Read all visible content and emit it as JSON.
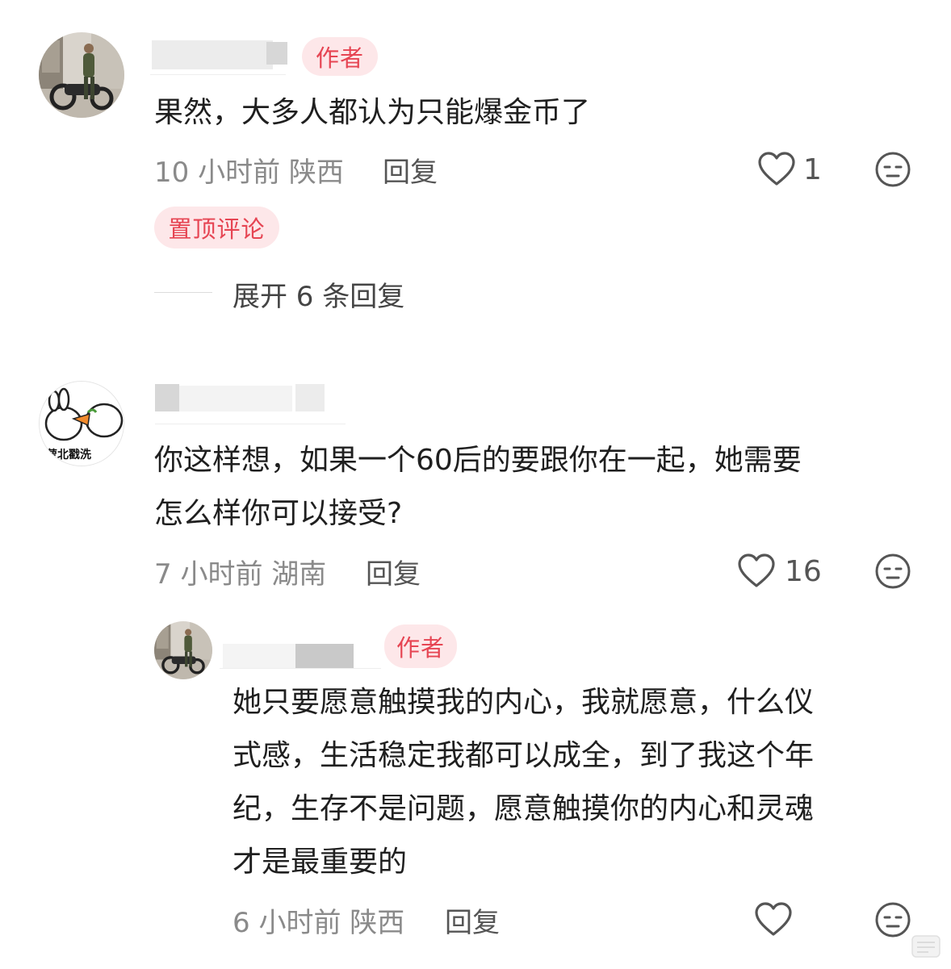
{
  "comments": [
    {
      "author_badge": "作者",
      "text": "果然，大多人都认为只能爆金币了",
      "time_location": "10 小时前 陕西",
      "reply_label": "回复",
      "likes": "1",
      "pinned_label": "置顶评论",
      "expand_label": "展开 6 条回复"
    },
    {
      "text_lines": [
        "你这样想，如果一个60后的要跟你在一起，她需要",
        "怎么样你可以接受?"
      ],
      "time_location": "7 小时前 湖南",
      "reply_label": "回复",
      "likes": "16",
      "avatar_text": "萝北戳洗"
    }
  ],
  "reply": {
    "author_badge": "作者",
    "text_lines": [
      "她只要愿意触摸我的内心，我就愿意，什么仪",
      "式感，生活稳定我都可以成全，到了我这个年",
      "纪，生存不是问题，愿意触摸你的内心和灵魂",
      "才是最重要的"
    ],
    "time_location": "6 小时前 陕西",
    "reply_label": "回复"
  },
  "icons": {
    "like": "heart-outline-icon",
    "react": "neutral-face-icon"
  },
  "colors": {
    "badge_bg": "#fde7e9",
    "badge_text": "#e64553",
    "meta_text": "#8a8a8a"
  }
}
